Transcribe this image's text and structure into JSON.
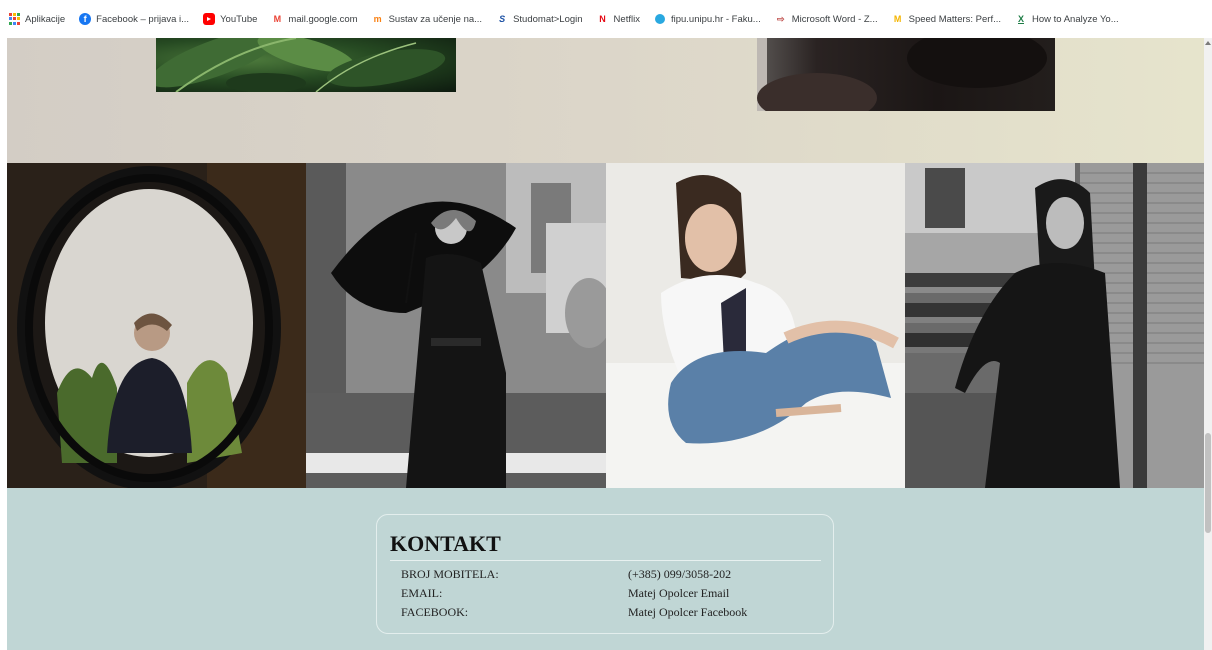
{
  "bookmarks": [
    {
      "label": "Aplikacije",
      "icon": "apps-grid-icon"
    },
    {
      "label": "Facebook – prijava i...",
      "icon": "facebook-icon"
    },
    {
      "label": "YouTube",
      "icon": "youtube-icon"
    },
    {
      "label": "mail.google.com",
      "icon": "gmail-icon"
    },
    {
      "label": "Sustav za učenje na...",
      "icon": "moodle-icon"
    },
    {
      "label": "Studomat>Login",
      "icon": "studomat-icon"
    },
    {
      "label": "Netflix",
      "icon": "netflix-icon"
    },
    {
      "label": "fipu.unipu.hr - Faku...",
      "icon": "fipu-icon"
    },
    {
      "label": "Microsoft Word - Z...",
      "icon": "word-icon"
    },
    {
      "label": "Speed Matters: Perf...",
      "icon": "speed-matters-icon"
    },
    {
      "label": "How to Analyze Yo...",
      "icon": "excel-icon"
    }
  ],
  "contact": {
    "title": "KONTAKT",
    "rows": [
      {
        "label": "BROJ MOBITELA:",
        "value": "(+385) 099/3058-202",
        "is_link": false
      },
      {
        "label": "EMAIL:",
        "value": "Matej Opolcer Email",
        "is_link": true
      },
      {
        "label": "FACEBOOK:",
        "value": "Matej Opolcer Facebook",
        "is_link": true
      }
    ]
  },
  "colors": {
    "contact_bg": "#c0d6d5",
    "link": "#2a6ad6",
    "hero_bg": "#dcd6c9"
  }
}
